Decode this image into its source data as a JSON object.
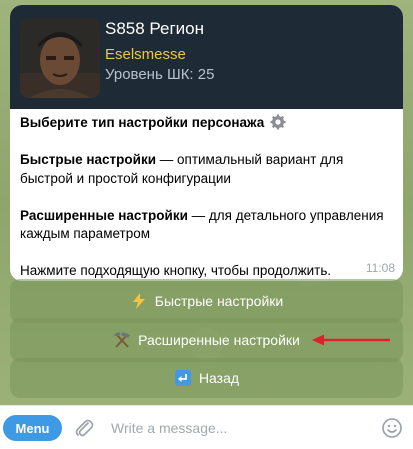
{
  "profile": {
    "player_name": "S858 Регион",
    "guild_name": "Eselsmesse",
    "level_text": "Уровень ШК: 25"
  },
  "message": {
    "title": "Выберите тип настройки персонажа",
    "quick_label": "Быстрые настройки",
    "quick_desc": " — оптимальный вариант для быстрой и простой конфигурации",
    "advanced_label": "Расширенные настройки",
    "advanced_desc": " — для детального управления каждым параметром",
    "prompt": "Нажмите подходящую кнопку, чтобы продолжить.",
    "time": "11:08"
  },
  "keyboard": {
    "buttons": [
      {
        "icon": "lightning-icon",
        "label": "Быстрые настройки"
      },
      {
        "icon": "hammer-pick-icon",
        "label": "Расширенные настройки"
      },
      {
        "icon": "back-arrow-icon",
        "label": "Назад"
      }
    ]
  },
  "composer": {
    "menu_label": "Menu",
    "placeholder": "Write a message..."
  },
  "colors": {
    "accent": "#3e9ae5",
    "guild": "#e9c84b",
    "annotation_arrow": "#e0202a"
  }
}
